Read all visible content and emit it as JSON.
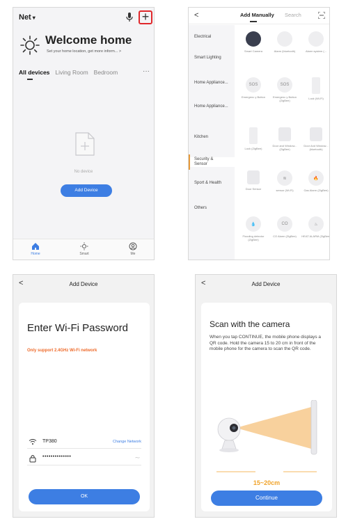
{
  "colors": {
    "accent": "#3d7ee3",
    "highlight": "#e0282c",
    "warning": "#ee6a2a",
    "measure": "#f0a32a"
  },
  "screen1": {
    "network": "Net",
    "welcome": "Welcome home",
    "subtitle": "Set your home location, get more inform...  >",
    "tabs": [
      "All devices",
      "Living Room",
      "Bedroom"
    ],
    "more": "···",
    "empty_text": "No device",
    "add_device": "Add Device",
    "nav": [
      "Home",
      "Smart",
      "Me"
    ]
  },
  "screen2": {
    "back": "<",
    "tab_manual": "Add Manually",
    "tab_search": "Search",
    "categories": [
      "Electrical",
      "Smart Lighting",
      "Home Appliance...",
      "Home Appliance...",
      "Kitchen",
      "Security & Sensor",
      "Sport & Health",
      "Others"
    ],
    "tiles": [
      "Smart Camera",
      "Alarm (bluetooth)",
      "Alarm system (...",
      "Emergenc y Button",
      "Emergenc y Button (ZigBee)",
      "Lock (Wi-Fi)",
      "Lock (ZigBee)",
      "Door and Window...(ZigBee)",
      "Door And Window...(bluetooth)",
      "Door Sensor",
      "sensor (Wi-Fi)",
      "Gas Alarm (ZigBee)",
      "Flooding detector (ZigBee)",
      "CO Alarm (ZigBee)",
      "HEAT ALARM (ZigBee)"
    ],
    "tile_glyphs": [
      "",
      "",
      "",
      "SOS",
      "SOS",
      "",
      "",
      "",
      "",
      "",
      "≋",
      "🔥",
      "💧",
      "CO",
      "♨"
    ]
  },
  "screen3": {
    "back": "<",
    "title": "Add Device",
    "heading": "Enter Wi-Fi Password",
    "warning": "Only support 2.4GHz Wi-Fi network",
    "ssid": "TP380",
    "change": "Change Network",
    "password": "••••••••••••••",
    "ok": "OK"
  },
  "screen4": {
    "back": "<",
    "title": "Add Device",
    "heading": "Scan with the camera",
    "description": "When you tap CONTINUE, the mobile phone displays a QR code. Hold the camera 15 to 20 cm in front of the mobile phone for the camera to scan the QR code.",
    "distance": "15~20cm",
    "continue": "Continue"
  }
}
